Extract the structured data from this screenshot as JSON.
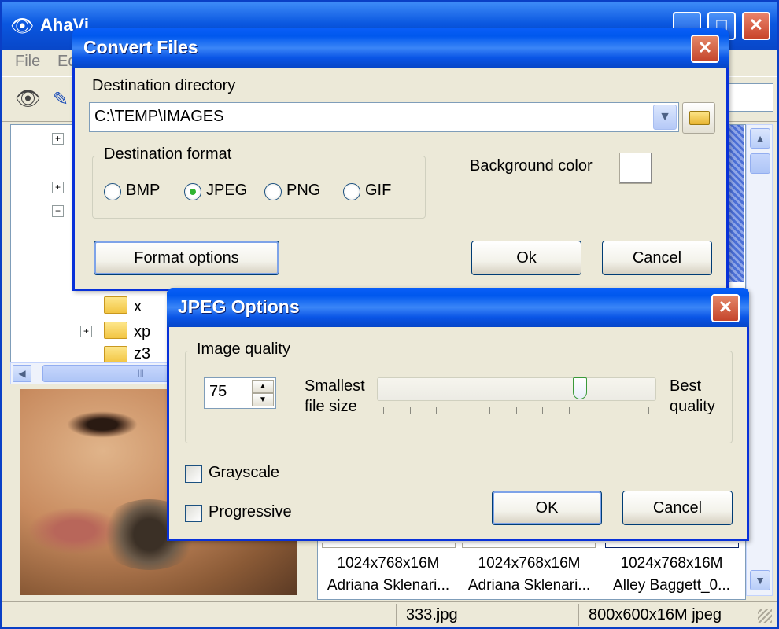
{
  "main": {
    "title": "AhaVi",
    "menu": [
      "File",
      "Ed"
    ],
    "tree_items": [
      "x",
      "xp",
      "z3"
    ],
    "thumbs": [
      {
        "size": "1024x768x16M",
        "name": "Adriana Sklenari..."
      },
      {
        "size": "1024x768x16M",
        "name": "Adriana Sklenari..."
      },
      {
        "size": "1024x768x16M",
        "name": "Alley Baggett_0..."
      }
    ],
    "status": {
      "file": "333.jpg",
      "info": "800x600x16M jpeg"
    }
  },
  "convert": {
    "title": "Convert Files",
    "dest_dir_label": "Destination directory",
    "dest_dir_value": "C:\\TEMP\\IMAGES",
    "format_label": "Destination format",
    "formats": [
      "BMP",
      "JPEG",
      "PNG",
      "GIF"
    ],
    "selected_format": "JPEG",
    "bg_color_label": "Background color",
    "bg_color": "#ffffff",
    "format_options_btn": "Format options",
    "ok_btn": "Ok",
    "cancel_btn": "Cancel"
  },
  "jpeg": {
    "title": "JPEG Options",
    "quality_label": "Image quality",
    "quality_value": "75",
    "quality_fraction": 0.75,
    "smallest_label": "Smallest\nfile size",
    "best_label": "Best\nquality",
    "grayscale_label": "Grayscale",
    "grayscale_checked": false,
    "progressive_label": "Progressive",
    "progressive_checked": false,
    "ok_btn": "OK",
    "cancel_btn": "Cancel"
  },
  "colors": {
    "title_bar": "#0a5ef8",
    "face": "#ece9d8",
    "close": "#c4452b"
  }
}
